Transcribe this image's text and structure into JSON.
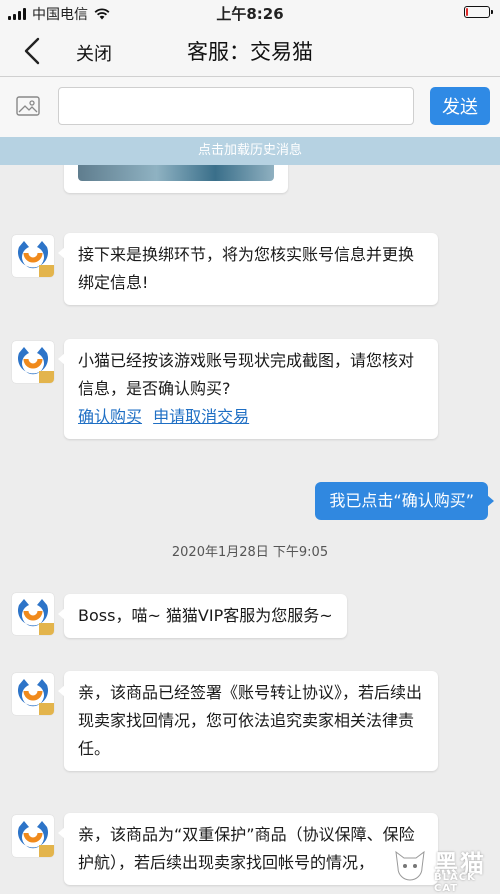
{
  "status_bar": {
    "carrier": "中国电信",
    "time": "上午8:26",
    "battery_level_percent": 10,
    "battery_color": "#e02b2b"
  },
  "nav": {
    "close_label": "关闭",
    "title": "客服：交易猫"
  },
  "input_bar": {
    "placeholder": "",
    "value": "",
    "send_label": "发送",
    "send_color": "#2f8ae5"
  },
  "history": {
    "label": "点击加载历史消息"
  },
  "messages": {
    "m1": "接下来是换绑环节，将为您核实账号信息并更换绑定信息!",
    "m2": "小猫已经按该游戏账号现状完成截图，请您核对信息，是否确认购买?",
    "m2_links": [
      "确认购买",
      "申请取消交易"
    ],
    "my_msg": "我已点击“确认购买”",
    "timestamp": "2020年1月28日 下午9:05",
    "m3": "Boss，喵~ 猫猫VIP客服为您服务~",
    "m4": "亲，该商品已经签署《账号转让协议》，若后续出现卖家找回情况，您可依法追究卖家相关法律责任。",
    "m5": "亲，该商品为“双重保护”商品（协议保障、保险护航），若后续出现卖家找回帐号的情况，"
  },
  "watermark": {
    "text": "黑猫",
    "sub": "BLACK CAT"
  },
  "icons": [
    "back-chevron-icon",
    "image-icon",
    "wifi-icon",
    "signal-icon",
    "battery-icon",
    "cat-avatar-icon"
  ]
}
